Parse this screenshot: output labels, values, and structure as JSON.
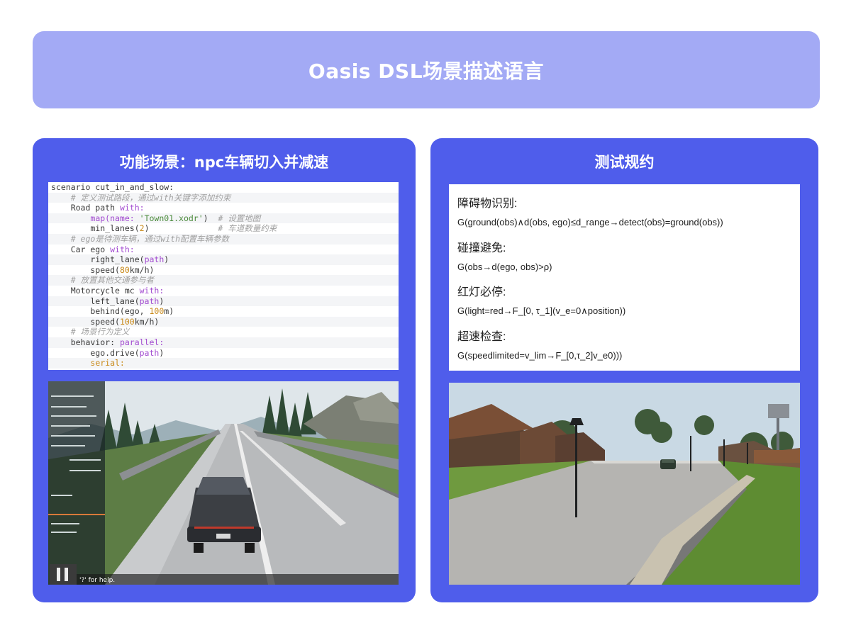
{
  "title": "Oasis DSL场景描述语言",
  "left_panel": {
    "title": "功能场景：npc车辆切入并减速",
    "hud_help": "'?' for help."
  },
  "right_panel": {
    "title": "测试规约",
    "specs": [
      {
        "heading": "障碍物识别:",
        "formula": "G(ground(obs)∧d(obs, ego)≤d_range→detect(obs)=ground(obs))"
      },
      {
        "heading": "碰撞避免:",
        "formula": "G(obs→d(ego, obs)>ρ)"
      },
      {
        "heading": "红灯必停:",
        "formula": "G(light=red→F_[0, τ_1](v_e=0∧position))"
      },
      {
        "heading": "超速检查:",
        "formula": "G(speedlimited=v_lim→F_[0,τ_2]v_e0)))"
      }
    ]
  },
  "code": [
    [
      {
        "t": "scenario cut_in_and_slow:",
        "c": ""
      }
    ],
    [
      {
        "t": "    # 定义测试路段，通过with关键字添加约束",
        "c": "cm"
      }
    ],
    [
      {
        "t": "    Road path ",
        "c": ""
      },
      {
        "t": "with:",
        "c": "kw"
      }
    ],
    [
      {
        "t": "        ",
        "c": ""
      },
      {
        "t": "map(name: ",
        "c": "kw"
      },
      {
        "t": "'Town01.xodr'",
        "c": "st"
      },
      {
        "t": ")  ",
        "c": ""
      },
      {
        "t": "# 设置地图",
        "c": "cm"
      }
    ],
    [
      {
        "t": "        min_lanes(",
        "c": ""
      },
      {
        "t": "2",
        "c": "nm"
      },
      {
        "t": ")              ",
        "c": ""
      },
      {
        "t": "# 车道数量约束",
        "c": "cm"
      }
    ],
    [
      {
        "t": "    # ego是待测车辆，通过with配置车辆参数",
        "c": "cm"
      }
    ],
    [
      {
        "t": "    Car ego ",
        "c": ""
      },
      {
        "t": "with:",
        "c": "kw"
      }
    ],
    [
      {
        "t": "        right_lane(",
        "c": ""
      },
      {
        "t": "path",
        "c": "kw"
      },
      {
        "t": ")",
        "c": ""
      }
    ],
    [
      {
        "t": "        speed(",
        "c": ""
      },
      {
        "t": "80",
        "c": "nm"
      },
      {
        "t": "km/h)",
        "c": ""
      }
    ],
    [
      {
        "t": "    # 放置其他交通参与者",
        "c": "cm"
      }
    ],
    [
      {
        "t": "    Motorcycle mc ",
        "c": ""
      },
      {
        "t": "with:",
        "c": "kw"
      }
    ],
    [
      {
        "t": "        left_lane(",
        "c": ""
      },
      {
        "t": "path",
        "c": "kw"
      },
      {
        "t": ")",
        "c": ""
      }
    ],
    [
      {
        "t": "        behind(ego, ",
        "c": ""
      },
      {
        "t": "100",
        "c": "nm"
      },
      {
        "t": "m)",
        "c": ""
      }
    ],
    [
      {
        "t": "        speed(",
        "c": ""
      },
      {
        "t": "100",
        "c": "nm"
      },
      {
        "t": "km/h)",
        "c": ""
      }
    ],
    [
      {
        "t": "    # 场景行为定义",
        "c": "cm"
      }
    ],
    [
      {
        "t": "    behavior: ",
        "c": ""
      },
      {
        "t": "parallel:",
        "c": "kw"
      }
    ],
    [
      {
        "t": "        ego.drive(",
        "c": ""
      },
      {
        "t": "path",
        "c": "kw"
      },
      {
        "t": ")",
        "c": ""
      }
    ],
    [
      {
        "t": "        ",
        "c": ""
      },
      {
        "t": "serial:",
        "c": "nm"
      }
    ]
  ]
}
